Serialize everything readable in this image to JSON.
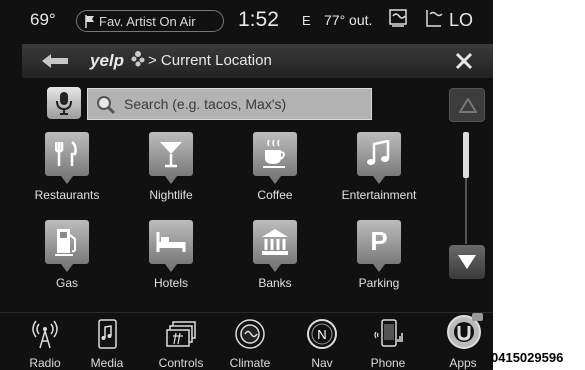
{
  "status_bar": {
    "temp_in": "69°",
    "favorite": "Fav. Artist On Air",
    "time": "1:52",
    "compass": "E",
    "temp_out": "77° out.",
    "fan_level": "LO"
  },
  "nav_bar": {
    "back_icon": "back-arrow-icon",
    "brand": "yelp",
    "title": "> Current Location",
    "close_icon": "close-icon"
  },
  "search": {
    "placeholder": "Search (e.g. tacos, Max's)",
    "mic_icon": "microphone-icon",
    "search_icon": "search-icon"
  },
  "categories": [
    {
      "label": "Restaurants",
      "icon": "fork-knife-icon"
    },
    {
      "label": "Nightlife",
      "icon": "cocktail-icon"
    },
    {
      "label": "Coffee",
      "icon": "coffee-cup-icon"
    },
    {
      "label": "Entertainment",
      "icon": "music-note-icon"
    },
    {
      "label": "Gas",
      "icon": "gas-pump-icon"
    },
    {
      "label": "Hotels",
      "icon": "bed-icon"
    },
    {
      "label": "Banks",
      "icon": "bank-icon"
    },
    {
      "label": "Parking",
      "icon": "parking-icon",
      "glyph": "P"
    }
  ],
  "scroll": {
    "up_icon": "scroll-up-icon",
    "down_icon": "scroll-down-icon"
  },
  "bottom_bar": [
    {
      "label": "Radio",
      "icon": "radio-icon"
    },
    {
      "label": "Media",
      "icon": "media-icon"
    },
    {
      "label": "Controls",
      "icon": "controls-icon"
    },
    {
      "label": "Climate",
      "icon": "climate-icon"
    },
    {
      "label": "Nav",
      "icon": "nav-compass-icon",
      "glyph": "N"
    },
    {
      "label": "Phone",
      "icon": "phone-icon"
    },
    {
      "label": "Apps",
      "icon": "apps-icon"
    }
  ],
  "figure_code": "0415029596"
}
